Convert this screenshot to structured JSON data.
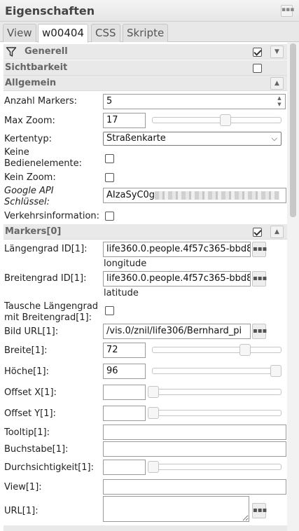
{
  "panel": {
    "title": "Eigenschaften"
  },
  "tabs": [
    {
      "label": "View"
    },
    {
      "label": "w00404"
    },
    {
      "label": "CSS"
    },
    {
      "label": "Skripte"
    }
  ],
  "groups": {
    "generell": {
      "title": "Generell",
      "checked": true
    },
    "sichtbarkeit": {
      "title": "Sichtbarkeit",
      "checked": false
    },
    "allgemein": {
      "title": "Allgemein"
    },
    "markers0": {
      "title": "Markers[0]",
      "checked": true
    }
  },
  "fields": {
    "anzahl_markers": {
      "label": "Anzahl Markers:",
      "value": "5"
    },
    "max_zoom": {
      "label": "Max Zoom:",
      "value": "17",
      "slider_fraction": 0.5
    },
    "kartentyp": {
      "label": "Kertentyp:",
      "value": "Straßenkarte"
    },
    "keine_bedienelemente": {
      "label_line1": "Keine",
      "label_line2": "Bedienelemente:",
      "checked": false
    },
    "kein_zoom": {
      "label": "Kein Zoom:",
      "checked": false
    },
    "google_api": {
      "label_line1": "Google API",
      "label_line2": "Schlüssel:",
      "value_visible": "AIzaSyC0g"
    },
    "verkehrsinformation": {
      "label": "Verkehrsinformation:",
      "checked": false
    },
    "laengengrad": {
      "label": "Längengrad ID[1]:",
      "value": "life360.0.people.4f57c365-bbd8",
      "sub": "longitude"
    },
    "breitengrad": {
      "label": "Breitengrad ID[1]:",
      "value": "life360.0.people.4f57c365-bbd8",
      "sub": "latitude"
    },
    "tausche": {
      "label_line1": "Tausche Längengrad",
      "label_line2": "mit Breitengrad[1]:",
      "checked": false
    },
    "bild_url": {
      "label": "Bild URL[1]:",
      "value": "/vis.0/znil/life306/Bernhard_pi"
    },
    "breite": {
      "label": "Breite[1]:",
      "value": "72",
      "slider_fraction": 0.72
    },
    "hoehe": {
      "label": "Höche[1]:",
      "value": "96",
      "slider_fraction": 0.96
    },
    "offset_x": {
      "label": "Offset X[1]:",
      "value": "",
      "slider_fraction": 0
    },
    "offset_y": {
      "label": "Offset Y[1]:",
      "value": "",
      "slider_fraction": 0
    },
    "tooltip": {
      "label": "Tooltip[1]:",
      "value": ""
    },
    "buchstabe": {
      "label": "Buchstabe[1]:",
      "value": ""
    },
    "durchsichtigkeit": {
      "label": "Durchsichtigkeit[1]:",
      "value": "",
      "slider_fraction": 0
    },
    "view": {
      "label": "View[1]:",
      "value": ""
    },
    "url": {
      "label": "URL[1]:",
      "value": ""
    }
  },
  "icons": {
    "filter": "filter-icon",
    "collapse": "chevron-up-icon",
    "expand": "chevron-down-icon",
    "picker": "ellipsis-icon",
    "panel_menu": "grip-icon"
  }
}
